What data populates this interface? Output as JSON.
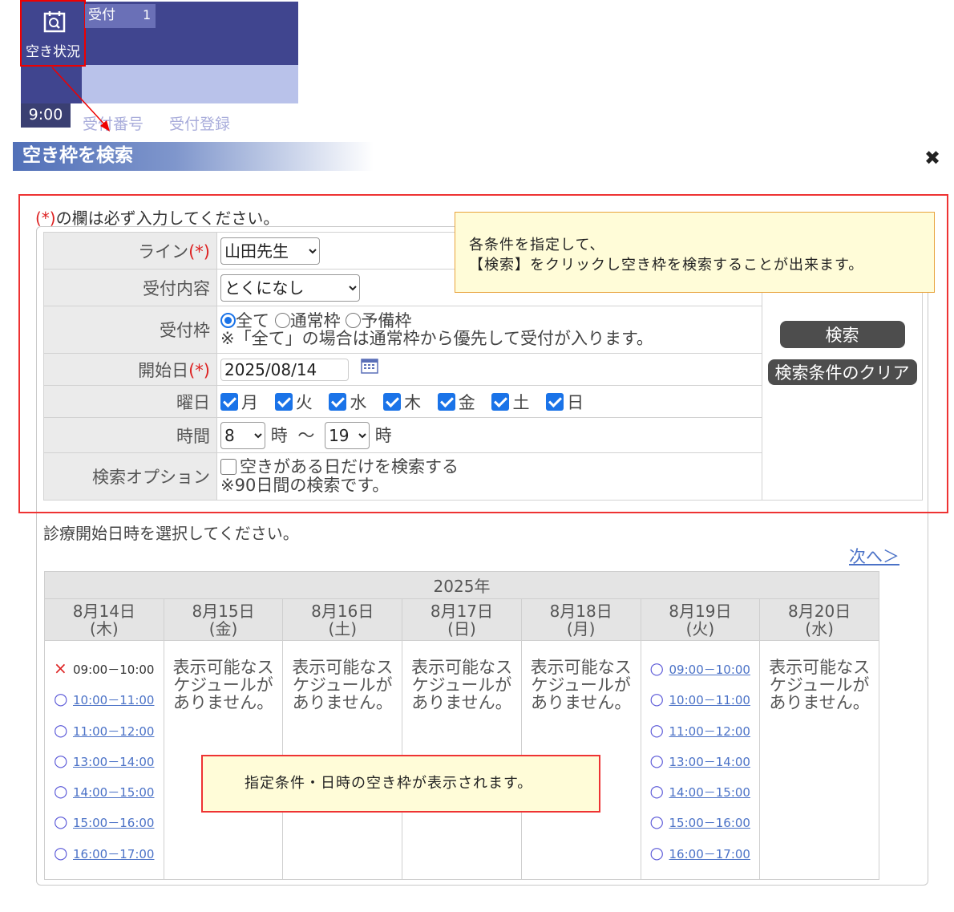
{
  "top": {
    "vacancy_label": "空き状況",
    "tab_label": "受付",
    "tab_count": "1",
    "time": "9:00",
    "link_number": "受付番号",
    "link_register": "受付登録"
  },
  "dialog": {
    "title": "空き枠を検索",
    "close": "✖"
  },
  "form": {
    "note_req": "(*)",
    "note_text": "の欄は必ず入力してください。",
    "req_mark": "(*)",
    "line_label": "ライン",
    "line_value": "山田先生",
    "content_label": "受付内容",
    "content_value": "とくになし",
    "frame_label": "受付枠",
    "frame_opt_all": "全て",
    "frame_opt_normal": "通常枠",
    "frame_opt_spare": "予備枠",
    "frame_note": "※「全て」の場合は通常枠から優先して受付が入ります。",
    "start_label": "開始日",
    "start_value": "2025/08/14",
    "weekday_label": "曜日",
    "weekdays": [
      "月",
      "火",
      "水",
      "木",
      "金",
      "土",
      "日"
    ],
    "time_label": "時間",
    "time_from": "8",
    "time_to": "19",
    "hour_unit": "時",
    "tilde": "～",
    "option_label": "検索オプション",
    "option_text": "空きがある日だけを検索する",
    "option_note": "※90日間の検索です。",
    "search_button": "検索",
    "clear_button": "検索条件のクリア"
  },
  "callouts": {
    "top_line1": "各条件を指定して、",
    "top_line2": "【検索】をクリックし空き枠を検索することが出来ます。",
    "bottom": "指定条件・日時の空き枠が表示されます。"
  },
  "schedule": {
    "intro": "診療開始日時を選択してください。",
    "next": "次へ＞",
    "year": "2025年",
    "no_schedule_line1": "表示可能なス",
    "no_schedule_line2": "ケジュールが",
    "no_schedule_line3": "ありません。",
    "days": [
      {
        "date": "8月14日",
        "dow": "(木)"
      },
      {
        "date": "8月15日",
        "dow": "(金)"
      },
      {
        "date": "8月16日",
        "dow": "(土)"
      },
      {
        "date": "8月17日",
        "dow": "(日)"
      },
      {
        "date": "8月18日",
        "dow": "(月)"
      },
      {
        "date": "8月19日",
        "dow": "(火)"
      },
      {
        "date": "8月20日",
        "dow": "(水)"
      }
    ],
    "slots_0814": [
      {
        "mark": "×",
        "time": "09:00－10:00"
      },
      {
        "mark": "○",
        "time": "10:00－11:00"
      },
      {
        "mark": "○",
        "time": "11:00－12:00"
      },
      {
        "mark": "○",
        "time": "13:00－14:00"
      },
      {
        "mark": "○",
        "time": "14:00－15:00"
      },
      {
        "mark": "○",
        "time": "15:00－16:00"
      },
      {
        "mark": "○",
        "time": "16:00－17:00"
      }
    ],
    "slots_0819": [
      {
        "mark": "○",
        "time": "09:00－10:00"
      },
      {
        "mark": "○",
        "time": "10:00－11:00"
      },
      {
        "mark": "○",
        "time": "11:00－12:00"
      },
      {
        "mark": "○",
        "time": "13:00－14:00"
      },
      {
        "mark": "○",
        "time": "14:00－15:00"
      },
      {
        "mark": "○",
        "time": "15:00－16:00"
      },
      {
        "mark": "○",
        "time": "16:00－17:00"
      }
    ]
  },
  "colors": {
    "header_dark": "#40458f",
    "header_light": "#b9c2ea",
    "accent_blue": "#1a73e8",
    "link_blue": "#4b72c7",
    "highlight_red": "#e33333",
    "callout_bg": "#fffcd8"
  }
}
